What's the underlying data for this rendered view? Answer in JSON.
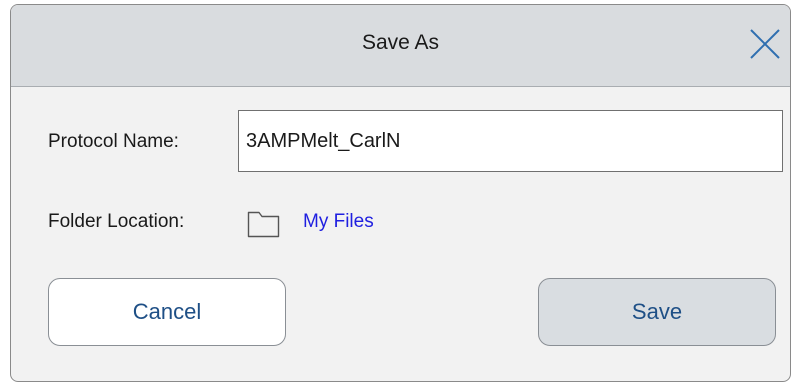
{
  "dialog": {
    "title": "Save As",
    "close_icon": "close-icon"
  },
  "form": {
    "protocol_name_label": "Protocol Name:",
    "protocol_name_value": "3AMPMelt_CarlN",
    "folder_location_label": "Folder Location:",
    "folder_icon": "folder-icon",
    "folder_location_value": "My Files"
  },
  "buttons": {
    "cancel_label": "Cancel",
    "save_label": "Save"
  },
  "colors": {
    "titlebar": "#d9dcdf",
    "body": "#f2f2f2",
    "link": "#1f1fe0",
    "button_text": "#1e4f86",
    "save_button_bg": "#d9dde1"
  }
}
